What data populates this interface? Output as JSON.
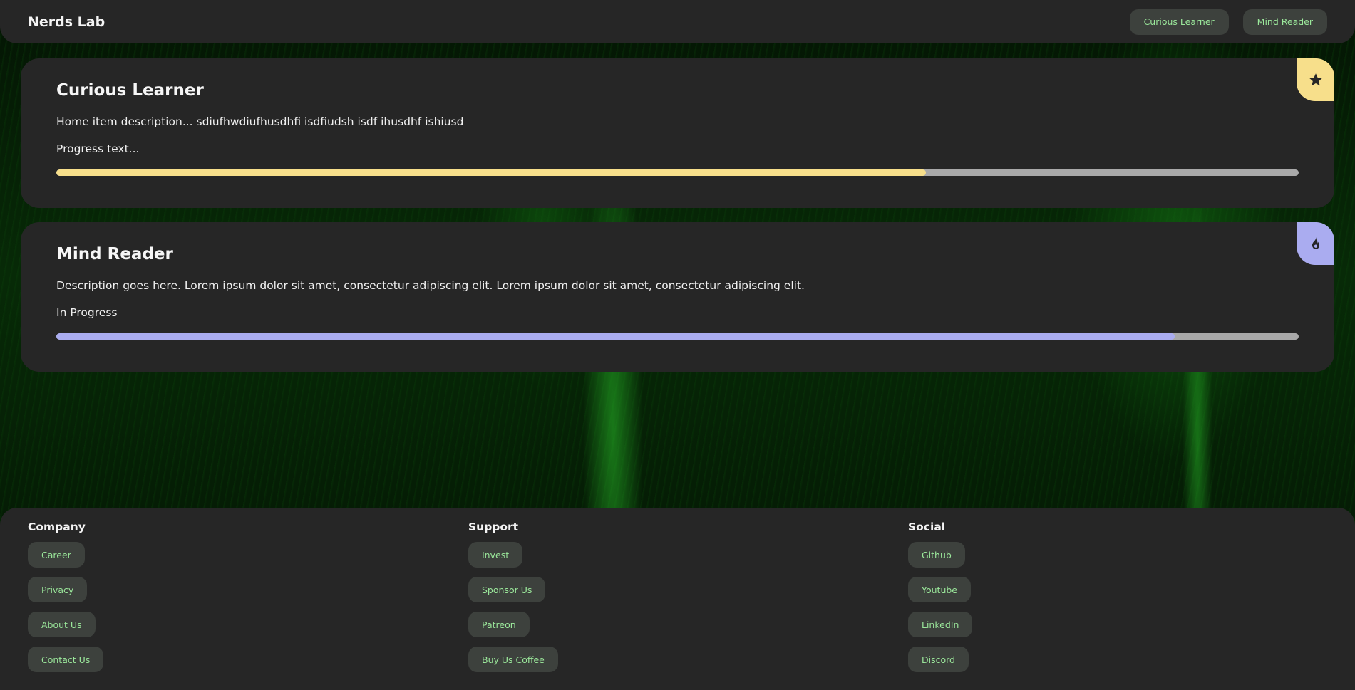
{
  "header": {
    "brand": "Nerds Lab",
    "nav": [
      "Curious Learner",
      "Mind Reader"
    ]
  },
  "cards": [
    {
      "title": "Curious Learner",
      "description": "Home item description... sdiufhwdiufhusdhfi isdfiudsh isdf ihusdhf ishiusd",
      "progress_text": "Progress text...",
      "progress": 0.7,
      "accent": "#f7df8b",
      "icon": "star-icon"
    },
    {
      "title": "Mind Reader",
      "description": "Description goes here. Lorem ipsum dolor sit amet, consectetur adipiscing elit. Lorem ipsum dolor sit amet, consectetur adipiscing elit.",
      "progress_text": "In Progress",
      "progress": 0.9,
      "accent": "#aaacf0",
      "icon": "flame-icon"
    }
  ],
  "footer": {
    "columns": [
      {
        "heading": "Company",
        "links": [
          "Career",
          "Privacy",
          "About Us",
          "Contact Us"
        ]
      },
      {
        "heading": "Support",
        "links": [
          "Invest",
          "Sponsor Us",
          "Patreon",
          "Buy Us Coffee"
        ]
      },
      {
        "heading": "Social",
        "links": [
          "Github",
          "Youtube",
          "LinkedIn",
          "Discord"
        ]
      }
    ]
  },
  "colors": {
    "surface": "#262626",
    "pill_bg": "#3d413d",
    "pill_text": "#9be89b",
    "track": "#a9a9a9"
  }
}
